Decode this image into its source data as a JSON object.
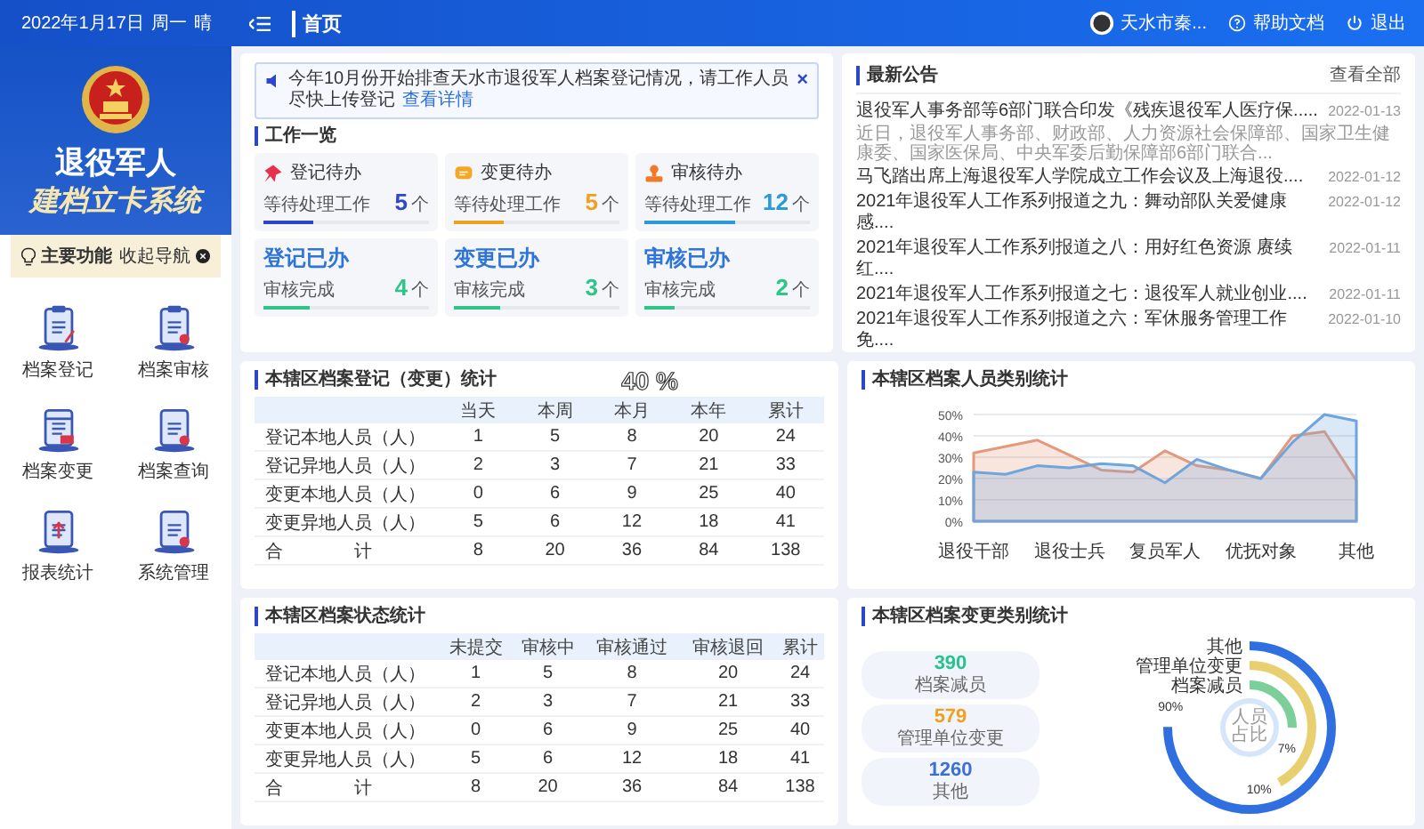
{
  "header": {
    "date": "2022年1月17日",
    "weekday": "周一",
    "weather": "晴",
    "page_title": "首页",
    "user": "天水市秦...",
    "links": [
      {
        "label": "帮助文档",
        "kind": "help"
      },
      {
        "label": "退出",
        "kind": "logout"
      }
    ]
  },
  "sidebar": {
    "title_line1": "退役军人",
    "title_line2": "建档立卡系统",
    "section": "主要功能",
    "collapse": "收起导航",
    "items": [
      {
        "label": "档案登记",
        "kind": "register"
      },
      {
        "label": "档案审核",
        "kind": "audit"
      },
      {
        "label": "档案变更",
        "kind": "change"
      },
      {
        "label": "档案查询",
        "kind": "query"
      },
      {
        "label": "报表统计",
        "kind": "report"
      },
      {
        "label": "系统管理",
        "kind": "system"
      }
    ]
  },
  "notice": {
    "text": "今年10月份开始排查天水市退役军人档案登记情况，请工作人员尽快上传登记",
    "link": "查看详情",
    "close": "×"
  },
  "work": {
    "title": "工作一览",
    "pending": [
      {
        "title": "登记待办",
        "kind": "pin",
        "subtitle": "等待处理工作",
        "count": "5",
        "unit": "个",
        "level": 0.3,
        "color": "#2d47c9"
      },
      {
        "title": "变更待办",
        "kind": "chat",
        "subtitle": "等待处理工作",
        "count": "5",
        "unit": "个",
        "level": 0.3,
        "color": "#f0a020"
      },
      {
        "title": "审核待办",
        "kind": "stamp",
        "subtitle": "等待处理工作",
        "count": "12",
        "unit": "个",
        "level": 0.55,
        "color": "#2a9ad8"
      }
    ],
    "done": [
      {
        "title": "登记已办",
        "subtitle": "审核完成",
        "count": "4",
        "unit": "个",
        "level": 0.28,
        "color": "#2fc48a"
      },
      {
        "title": "变更已办",
        "subtitle": "审核完成",
        "count": "3",
        "unit": "个",
        "level": 0.28,
        "color": "#2fc48a"
      },
      {
        "title": "审核已办",
        "subtitle": "审核完成",
        "count": "2",
        "unit": "个",
        "level": 0.18,
        "color": "#2fc48a"
      }
    ]
  },
  "announcements": {
    "title": "最新公告",
    "more": "查看全部",
    "items": [
      {
        "title": "退役军人事务部等6部门联合印发《残疾退役军人医疗保.....",
        "date": "2022-01-13",
        "summary": "近日，退役军人事务部、财政部、人力资源社会保障部、国家卫生健康委、国家医保局、中央军委后勤保障部6部门联合..."
      },
      {
        "title": "马飞踏出席上海退役军人学院成立工作会议及上海退役....",
        "date": "2022-01-12"
      },
      {
        "title": "2021年退役军人工作系列报道之九：舞动部队关爱健康感....",
        "date": "2022-01-12"
      },
      {
        "title": "2021年退役军人工作系列报道之八：用好红色资源 赓续红....",
        "date": "2022-01-11"
      },
      {
        "title": "2021年退役军人工作系列报道之七：退役军人就业创业....",
        "date": "2022-01-11"
      },
      {
        "title": "2021年退役军人工作系列报道之六：军休服务管理工作免....",
        "date": "2022-01-10"
      }
    ]
  },
  "stats_table": {
    "title": "本辖区档案登记（变更）统计",
    "overlay_text": "40 %",
    "columns": [
      "当天",
      "本周",
      "本月",
      "本年",
      "累计"
    ],
    "rows": [
      {
        "label": "登记本地人员（人）",
        "values": [
          "1",
          "5",
          "8",
          "20",
          "24"
        ]
      },
      {
        "label": "登记异地人员（人）",
        "values": [
          "2",
          "3",
          "7",
          "21",
          "33"
        ]
      },
      {
        "label": "变更本地人员（人）",
        "values": [
          "0",
          "6",
          "9",
          "25",
          "40"
        ]
      },
      {
        "label": "变更异地人员（人）",
        "values": [
          "5",
          "6",
          "12",
          "18",
          "41"
        ]
      }
    ],
    "total": {
      "label_parts": [
        "合",
        "计"
      ],
      "values": [
        "8",
        "20",
        "36",
        "84",
        "138"
      ]
    }
  },
  "category_chart": {
    "title": "本辖区档案人员类别统计",
    "chart_data": {
      "type": "area",
      "categories": [
        "退役干部",
        null,
        null,
        "退役士兵",
        null,
        null,
        "复员军人",
        null,
        null,
        "优抚对象",
        null,
        null,
        "其他"
      ],
      "ylim": [
        0,
        50
      ],
      "grid": true,
      "yticks": [
        {
          "value": 0,
          "label": "0%"
        },
        {
          "value": 10,
          "label": "10%"
        },
        {
          "value": 20,
          "label": "20%"
        },
        {
          "value": 30,
          "label": "30%"
        },
        {
          "value": 40,
          "label": "40%"
        },
        {
          "value": 50,
          "label": "50%"
        }
      ],
      "series": [
        {
          "color": "#e39a7c",
          "values": [
            32,
            35,
            38,
            31,
            24,
            23,
            33,
            26,
            24,
            20,
            40,
            42,
            19
          ]
        },
        {
          "color": "#6fa5dc",
          "values": [
            23,
            22,
            26,
            25,
            27,
            26,
            18,
            29,
            24,
            20,
            37,
            50,
            47
          ]
        }
      ]
    }
  },
  "status_table": {
    "title": "本辖区档案状态统计",
    "columns": [
      "未提交",
      "审核中",
      "审核通过",
      "审核退回",
      "累计"
    ],
    "rows": [
      {
        "label": "登记本地人员（人）",
        "values": [
          "1",
          "5",
          "8",
          "20",
          "24"
        ]
      },
      {
        "label": "登记异地人员（人）",
        "values": [
          "2",
          "3",
          "7",
          "21",
          "33"
        ]
      },
      {
        "label": "变更本地人员（人）",
        "values": [
          "0",
          "6",
          "9",
          "25",
          "40"
        ]
      },
      {
        "label": "变更异地人员（人）",
        "values": [
          "5",
          "6",
          "12",
          "18",
          "41"
        ]
      }
    ],
    "total": {
      "label_parts": [
        "合",
        "计"
      ],
      "values": [
        "8",
        "20",
        "36",
        "84",
        "138"
      ]
    }
  },
  "change_stats": {
    "title": "本辖区档案变更类别统计",
    "boxes": [
      {
        "value": "390",
        "label": "档案减员",
        "color": "#27c28e"
      },
      {
        "value": "579",
        "label": "管理单位变更",
        "color": "#f0a020"
      },
      {
        "value": "1260",
        "label": "其他",
        "color": "#3a6fd8"
      }
    ],
    "rings": [
      {
        "label": "其他",
        "percent": "90%",
        "level": 0.75,
        "color": "#2f6fe0"
      },
      {
        "label": "管理单位变更",
        "percent": "10%",
        "level": 0.42,
        "color": "#e8d070"
      },
      {
        "label": "档案减员",
        "percent": "7%",
        "level": 0.25,
        "color": "#7ccf9a"
      }
    ],
    "center_label": "人员占比"
  }
}
